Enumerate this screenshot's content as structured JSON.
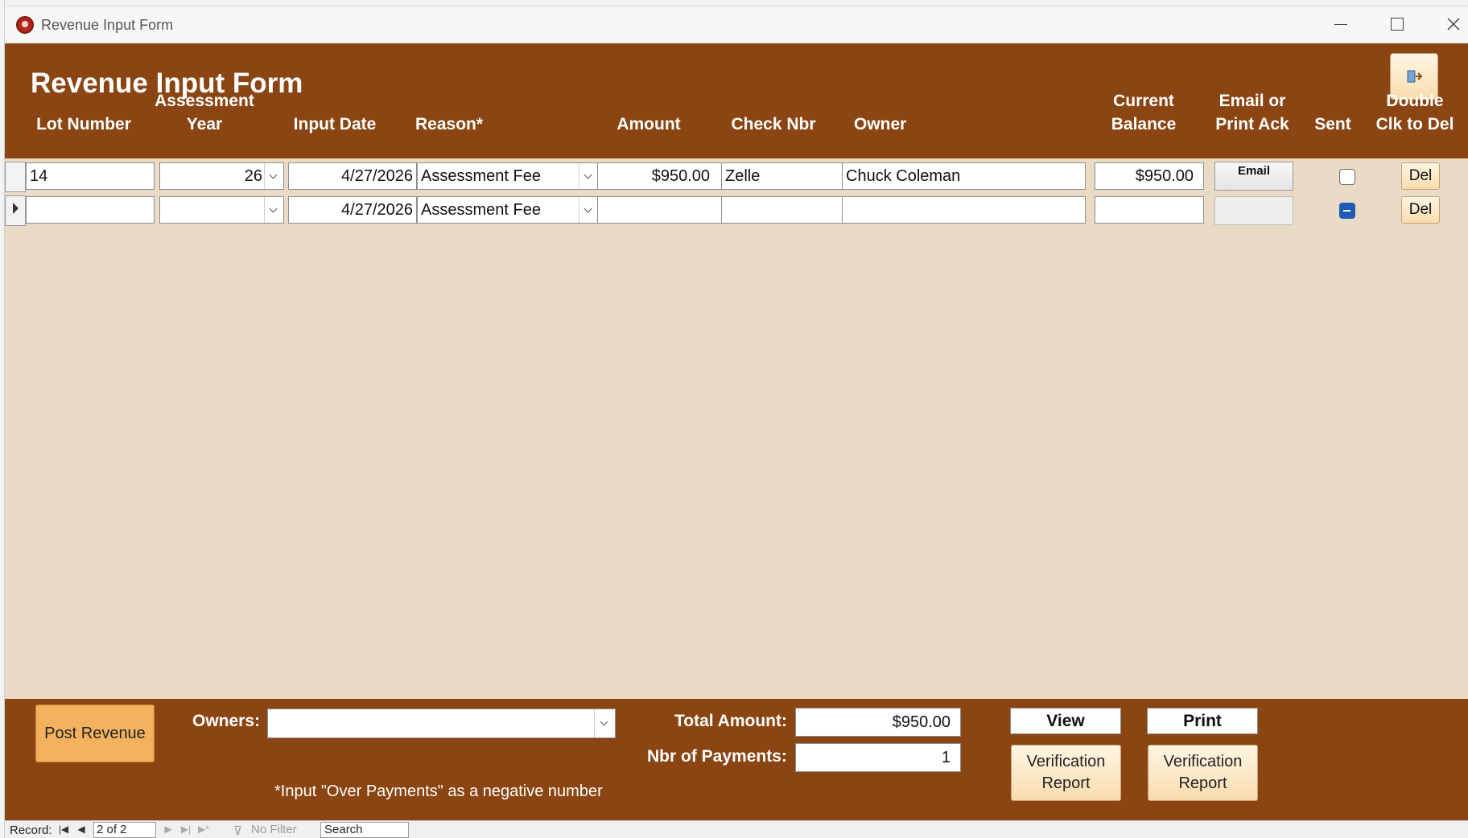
{
  "window": {
    "title": "Revenue Input Form"
  },
  "header": {
    "title": "Revenue Input Form",
    "columns": {
      "lot_number": "Lot Number",
      "assessment_year": [
        "Assessment",
        "Year"
      ],
      "input_date": "Input Date",
      "reason": "Reason*",
      "amount": "Amount",
      "check_nbr": "Check Nbr",
      "owner": "Owner",
      "current_balance": [
        "Current",
        "Balance"
      ],
      "email_ack": [
        "Email or",
        "Print Ack"
      ],
      "sent": "Sent",
      "double_clk": [
        "Double",
        "Clk to Del"
      ]
    }
  },
  "rows": [
    {
      "lot_number": "14",
      "assessment_year": "26",
      "input_date": "4/27/2026",
      "reason": "Assessment Fee",
      "amount": "$950.00",
      "check_nbr": "Zelle",
      "owner": "Chuck Coleman",
      "current_balance": "$950.00",
      "email_label": "Email",
      "sent": "unchecked",
      "del_label": "Del"
    },
    {
      "lot_number": "",
      "assessment_year": "",
      "input_date": "4/27/2026",
      "reason": "Assessment Fee",
      "amount": "",
      "check_nbr": "",
      "owner": "",
      "current_balance": "",
      "email_label": "",
      "sent": "indeterminate",
      "del_label": "Del"
    }
  ],
  "footer": {
    "post_revenue": "Post Revenue",
    "owners_label": "Owners:",
    "owners_value": "",
    "total_amount_label": "Total Amount:",
    "total_amount": "$950.00",
    "nbr_payments_label": "Nbr of Payments:",
    "nbr_payments": "1",
    "note": "*Input \"Over Payments\" as a negative number",
    "view_label": "View",
    "print_label": "Print",
    "verification_report": [
      "Verification",
      "Report"
    ]
  },
  "nav": {
    "record_label": "Record:",
    "position": "2 of 2",
    "filter": "No Filter",
    "search": "Search"
  },
  "colors": {
    "header_bg": "#8b4513",
    "detail_bg": "#e9dbc5",
    "post_button": "#f4b25f",
    "button_face": "#fadcaf"
  }
}
